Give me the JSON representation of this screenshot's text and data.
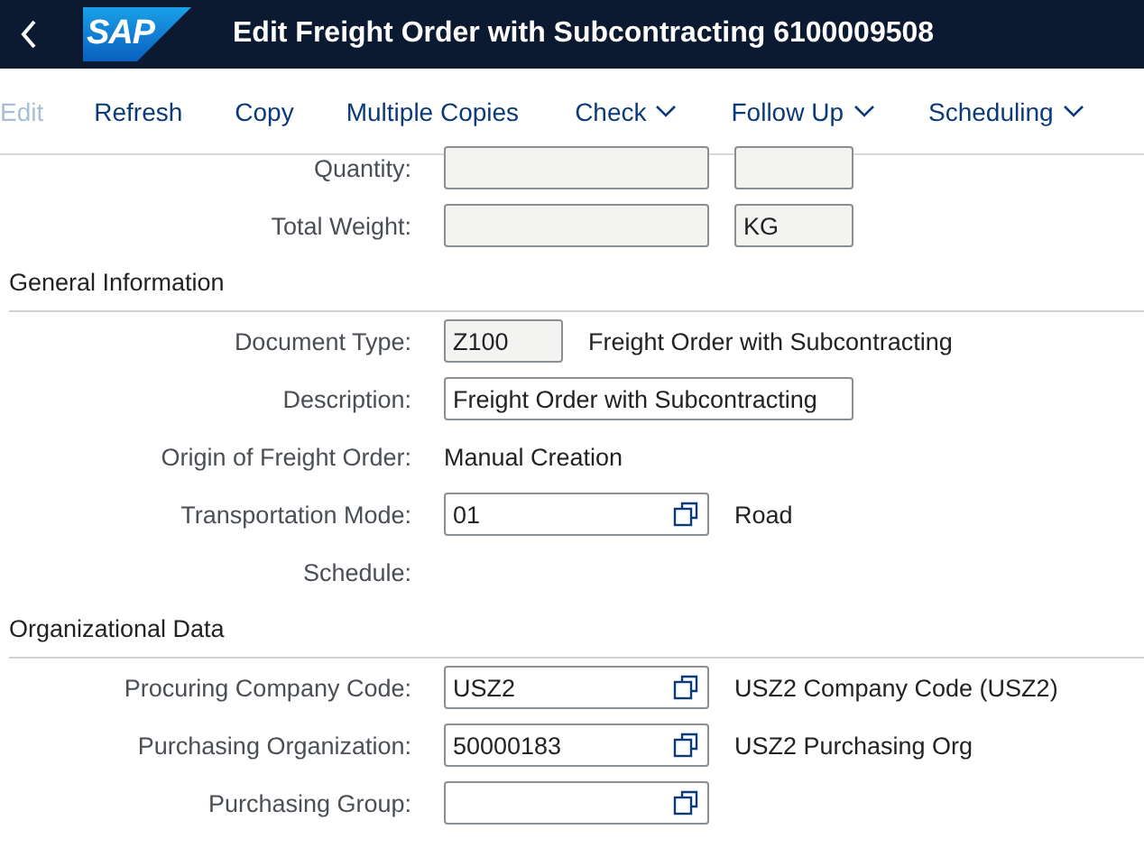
{
  "header": {
    "logo": "SAP",
    "title": "Edit Freight Order with Subcontracting 6100009508"
  },
  "toolbar": [
    {
      "label": "Edit",
      "kind": "button",
      "disabled": true
    },
    {
      "label": "Refresh",
      "kind": "button",
      "disabled": false
    },
    {
      "label": "Copy",
      "kind": "button",
      "disabled": false
    },
    {
      "label": "Multiple Copies",
      "kind": "button",
      "disabled": false
    },
    {
      "label": "Check",
      "kind": "menu",
      "disabled": false
    },
    {
      "label": "Follow Up",
      "kind": "menu",
      "disabled": false
    },
    {
      "label": "Scheduling",
      "kind": "menu",
      "disabled": false
    }
  ],
  "rows": [
    {
      "kind": "field",
      "label": "Quantity:",
      "fields": [
        {
          "kind": "readonly"
        },
        {
          "kind": "readonly_short"
        }
      ]
    },
    {
      "kind": "field",
      "label": "Total Weight:",
      "fields": [
        {
          "kind": "readonly"
        },
        {
          "kind": "readonly_short",
          "value": "KG"
        }
      ]
    },
    {
      "kind": "section",
      "title": "General Information"
    },
    {
      "kind": "field",
      "label": "Document Type:",
      "fields": [
        {
          "kind": "readonly_short",
          "value": "Z100"
        }
      ],
      "text": "Freight Order with Subcontracting"
    },
    {
      "kind": "field",
      "label": "Description:",
      "fields": [
        {
          "kind": "input_long",
          "value": "Freight Order with Subcontracting"
        }
      ]
    },
    {
      "kind": "field",
      "label": "Origin of Freight Order:",
      "text": "Manual Creation"
    },
    {
      "kind": "field",
      "label": "Transportation Mode:",
      "fields": [
        {
          "kind": "value_help",
          "value": "01"
        }
      ],
      "text": "Road"
    },
    {
      "kind": "field",
      "label": "Schedule:"
    },
    {
      "kind": "section",
      "title": "Organizational Data"
    },
    {
      "kind": "field",
      "label": "Procuring Company Code:",
      "fields": [
        {
          "kind": "value_help",
          "value": "USZ2"
        }
      ],
      "text": "USZ2 Company Code (USZ2)"
    },
    {
      "kind": "field",
      "label": "Purchasing Organization:",
      "fields": [
        {
          "kind": "value_help",
          "value": "50000183"
        }
      ],
      "text": "USZ2 Purchasing Org"
    },
    {
      "kind": "field",
      "label": "Purchasing Group:",
      "fields": [
        {
          "kind": "value_help"
        }
      ]
    }
  ]
}
